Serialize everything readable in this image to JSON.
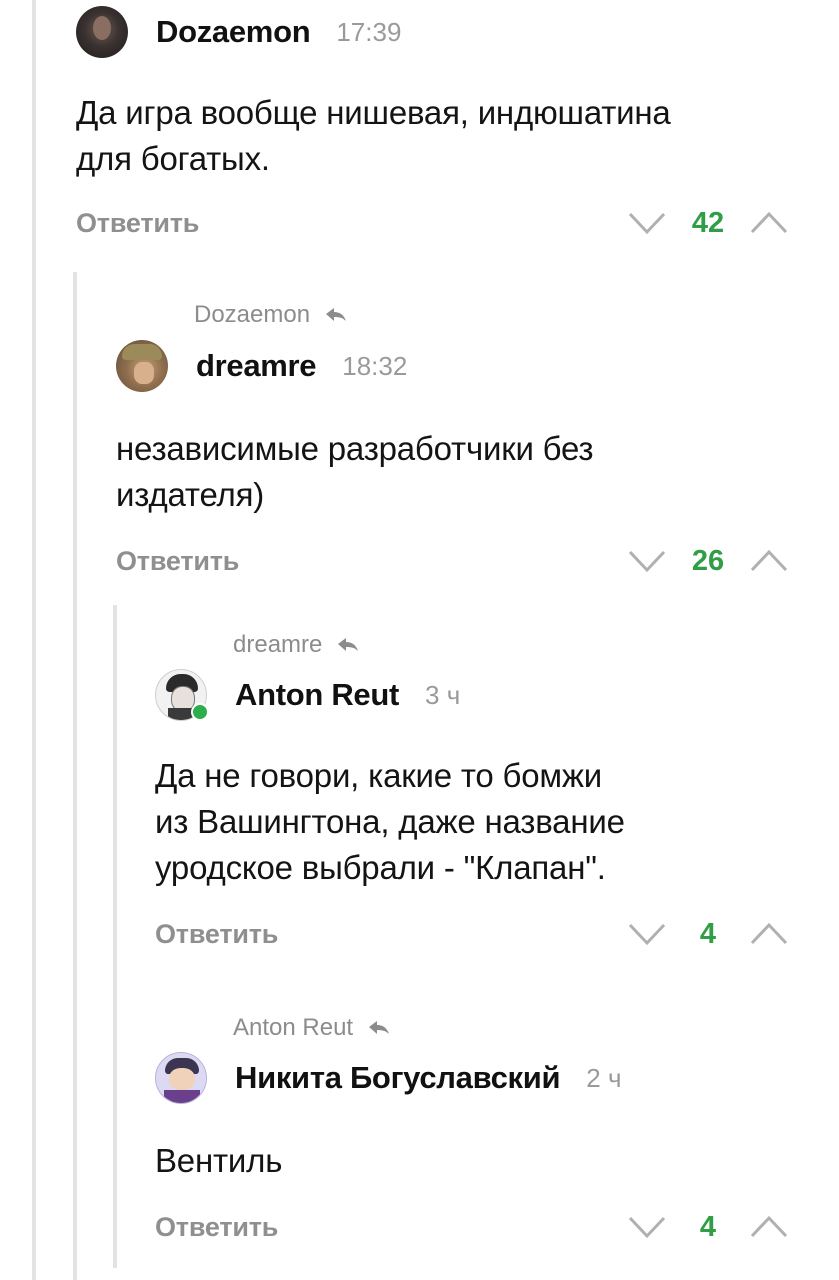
{
  "comments": [
    {
      "username": "Dozaemon",
      "time": "17:39",
      "text": "Да игра вообще нишевая, индюшатина\nдля богатых.",
      "reply_label": "Ответить",
      "score": "42"
    },
    {
      "reply_to": "Dozaemon",
      "username": "dreamre",
      "time": "18:32",
      "text": "независимые разработчики без\nиздателя)",
      "reply_label": "Ответить",
      "score": "26"
    },
    {
      "reply_to": "dreamre",
      "username": "Anton Reut",
      "time": "3 ч",
      "text": "Да не говори, какие то бомжи\nиз Вашингтона, даже название\nуродское выбрали - \"Клапан\".",
      "reply_label": "Ответить",
      "score": "4"
    },
    {
      "reply_to": "Anton Reut",
      "username": "Никита Богуславский",
      "time": "2 ч",
      "text": "Вентиль",
      "reply_label": "Ответить",
      "score": "4"
    }
  ],
  "colors": {
    "score": "#2f9e47",
    "muted": "#8f8f8f",
    "thread_line": "#e3e3e3",
    "online": "#2dae4b"
  },
  "icons": [
    "reply-arrow-icon",
    "downvote-icon",
    "upvote-icon",
    "online-indicator"
  ]
}
